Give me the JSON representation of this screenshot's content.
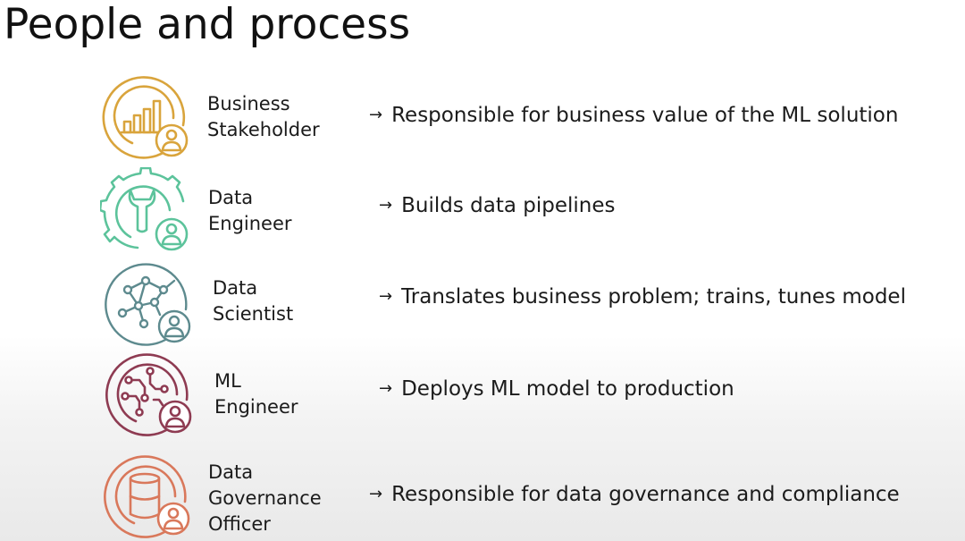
{
  "slide": {
    "title": "People and process"
  },
  "colors": {
    "business_stakeholder": "#d9a43c",
    "data_engineer": "#5cc39b",
    "data_scientist": "#5d8a8e",
    "ml_engineer": "#8e3b52",
    "data_governance_officer": "#d9785b"
  },
  "roles": [
    {
      "name_line1": "Business",
      "name_line2": "Stakeholder",
      "arrow": "→",
      "description": "Responsible for business value of the ML solution",
      "icon": "bar-chart-person-icon"
    },
    {
      "name_line1": "Data",
      "name_line2": "Engineer",
      "arrow": "→",
      "description": "Builds data pipelines",
      "icon": "gear-wrench-person-icon"
    },
    {
      "name_line1": "Data",
      "name_line2": "Scientist",
      "arrow": "→",
      "description": "Translates business problem; trains, tunes model",
      "icon": "network-person-icon"
    },
    {
      "name_line1": "ML",
      "name_line2": "Engineer",
      "arrow": "→",
      "description": "Deploys ML model to production",
      "icon": "circuit-person-icon"
    },
    {
      "name_line1": "Data",
      "name_line2": "Governance",
      "name_line3": "Officer",
      "arrow": "→",
      "description": "Responsible for data governance and compliance",
      "icon": "database-person-icon"
    }
  ]
}
